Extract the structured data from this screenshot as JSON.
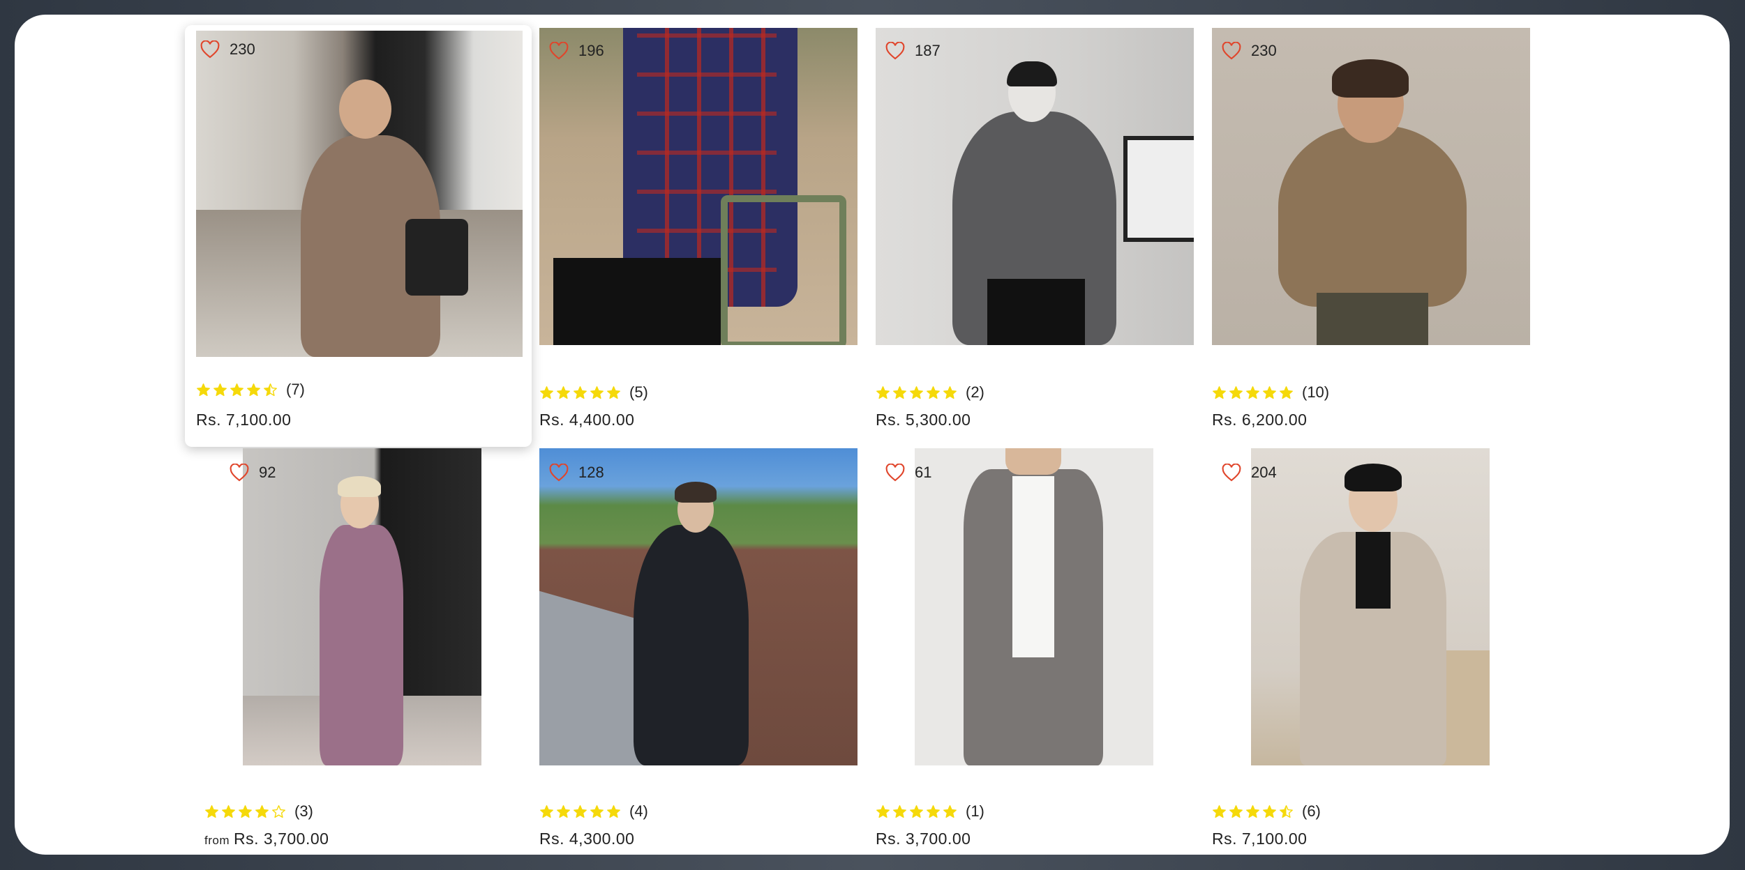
{
  "products": [
    {
      "likes": "230",
      "rating": 4.5,
      "reviews": "(7)",
      "price": "Rs. 7,100.00",
      "from": "",
      "image": "man in brown trench coat with black bag in hallway",
      "bg": "#b9aea2",
      "coat": "#8e7563",
      "hovered": true
    },
    {
      "likes": "196",
      "rating": 5,
      "reviews": "(5)",
      "price": "Rs. 4,400.00",
      "from": "",
      "image": "man in red and blue plaid jacket sitting on green chair",
      "bg": "#a89377",
      "coat": "#2c2f63"
    },
    {
      "likes": "187",
      "rating": 5,
      "reviews": "(2)",
      "price": "Rs. 5,300.00",
      "from": "",
      "image": "man in grey fleece zip jacket with cap and mask",
      "bg": "#c9c8c6",
      "coat": "#5a5a5c"
    },
    {
      "likes": "230",
      "rating": 5,
      "reviews": "(10)",
      "price": "Rs. 6,200.00",
      "from": "",
      "image": "man in tan puffer jacket",
      "bg": "#c1b8ad",
      "coat": "#8d7457"
    },
    {
      "likes": "92",
      "rating": 4,
      "reviews": "(3)",
      "price": "Rs. 3,700.00",
      "from": "from",
      "image": "man in lilac suit in hallway",
      "bg": "#a7a4a0",
      "coat": "#9b7089"
    },
    {
      "likes": "128",
      "rating": 5,
      "reviews": "(4)",
      "price": "Rs. 4,300.00",
      "from": "",
      "image": "man in black denim jacket by brick wall",
      "bg": "#7a5546",
      "coat": "#1f2228"
    },
    {
      "likes": "61",
      "rating": 5,
      "reviews": "(1)",
      "price": "Rs. 3,700.00",
      "from": "",
      "image": "man in grey suede jacket and pants",
      "bg": "#e9e8e6",
      "coat": "#7a7674"
    },
    {
      "likes": "204",
      "rating": 4.5,
      "reviews": "(6)",
      "price": "Rs. 7,100.00",
      "from": "",
      "image": "man in beige double-breasted overcoat",
      "bg": "#d6cfc6",
      "coat": "#c8bcae"
    }
  ],
  "colors": {
    "heart": "#e0452b",
    "star": "#f5d90a",
    "text": "#222222"
  }
}
